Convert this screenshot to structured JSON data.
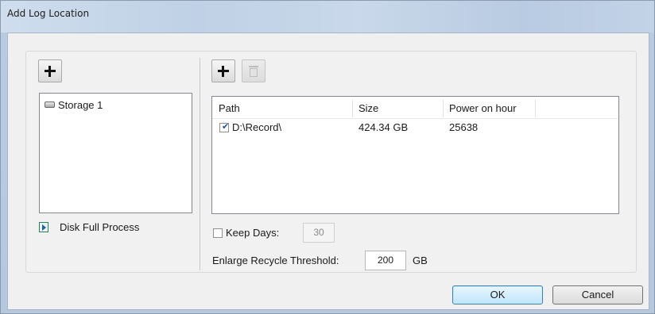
{
  "window": {
    "title": "Add Log Location"
  },
  "left_panel": {
    "storages": [
      {
        "label": "Storage 1",
        "icon": "drive-icon"
      }
    ],
    "disk_full_label": "Disk Full Process"
  },
  "right_panel": {
    "table": {
      "columns": [
        "Path",
        "Size",
        "Power on hour"
      ],
      "rows": [
        {
          "checked": true,
          "path": "D:\\Record\\",
          "size": "424.34 GB",
          "power_on_hour": "25638"
        }
      ]
    },
    "keep_days": {
      "label": "Keep Days:",
      "checked": false,
      "value": "30"
    },
    "recycle": {
      "label": "Enlarge Recycle Threshold:",
      "value": "200",
      "unit": "GB"
    }
  },
  "buttons": {
    "ok": "OK",
    "cancel": "Cancel"
  },
  "colors": {
    "title_bar": "#c3d3e4",
    "ok_border": "#3c7fb1"
  }
}
